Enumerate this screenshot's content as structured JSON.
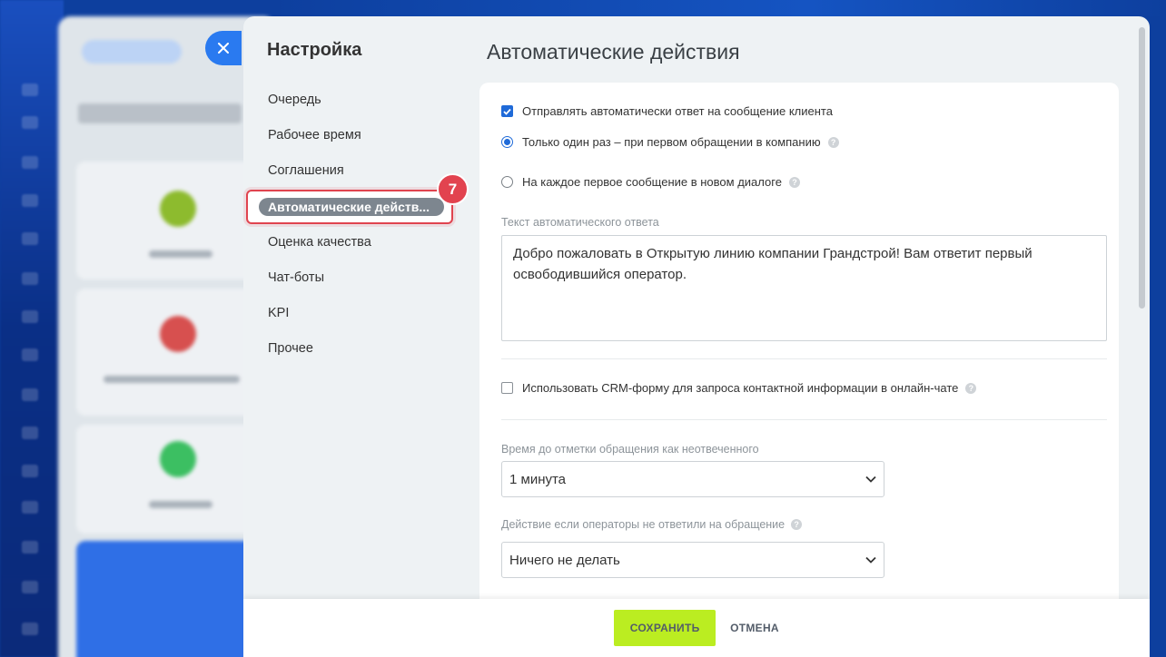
{
  "background": {
    "accent": "#2a7af0"
  },
  "nav": {
    "title": "Настройка",
    "items": [
      {
        "label": "Очередь"
      },
      {
        "label": "Рабочее время"
      },
      {
        "label": "Соглашения"
      },
      {
        "label": "Автоматические действ...",
        "active": true
      },
      {
        "label": "Оценка качества"
      },
      {
        "label": "Чат-боты"
      },
      {
        "label": "KPI"
      },
      {
        "label": "Прочее"
      }
    ],
    "step_badge": "7"
  },
  "content": {
    "title": "Автоматические действия",
    "auto_reply_checkbox": {
      "label": "Отправлять автоматически ответ на сообщение клиента",
      "checked": true
    },
    "radio_once": {
      "label": "Только один раз – при первом обращении в компанию",
      "selected": true
    },
    "radio_each": {
      "label": "На каждое первое сообщение в новом диалоге",
      "selected": false
    },
    "reply_text_label": "Текст автоматического ответа",
    "reply_text_value": "Добро пожаловать в Открытую линию компании Грандстрой! Вам ответит первый освободившийся оператор.",
    "crm_form_checkbox": {
      "label": "Использовать CRM-форму для запроса контактной информации в онлайн-чате",
      "checked": false
    },
    "unanswered_time_label": "Время до отметки обращения как неотвеченного",
    "unanswered_time_value": "1 минута",
    "no_answer_action_label": "Действие если операторы не ответили на обращение",
    "no_answer_action_value": "Ничего не делать"
  },
  "footer": {
    "save_label": "СОХРАНИТЬ",
    "cancel_label": "ОТМЕНА"
  },
  "colors": {
    "save_button": "#bbed21",
    "highlight": "#e2434f",
    "checkbox": "#1f6ad8"
  }
}
